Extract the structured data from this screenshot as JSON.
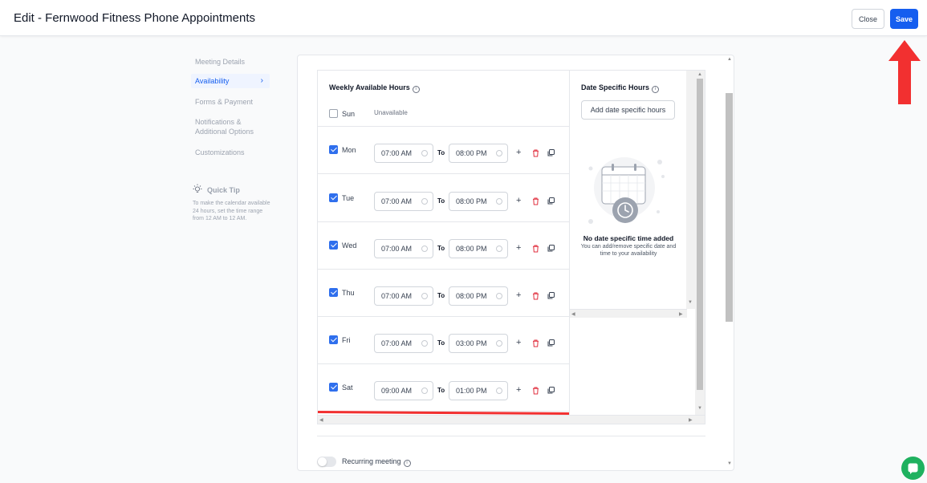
{
  "header": {
    "title": "Edit - Fernwood Fitness Phone Appointments",
    "close_label": "Close",
    "save_label": "Save"
  },
  "sidebar": {
    "items": [
      {
        "label": "Meeting Details"
      },
      {
        "label": "Availability",
        "active": true
      },
      {
        "label": "Forms & Payment"
      },
      {
        "label": "Notifications & Additional Options"
      },
      {
        "label": "Customizations"
      }
    ],
    "tip_title": "Quick Tip",
    "tip_text": "To make the calendar available 24 hours, set the time range from 12 AM to 12 AM."
  },
  "weekly": {
    "title": "Weekly Available Hours",
    "to_label": "To",
    "unavailable_label": "Unavailable",
    "days": [
      {
        "day": "Sun",
        "checked": false
      },
      {
        "day": "Mon",
        "checked": true,
        "from": "07:00 AM",
        "to": "08:00 PM"
      },
      {
        "day": "Tue",
        "checked": true,
        "from": "07:00 AM",
        "to": "08:00 PM"
      },
      {
        "day": "Wed",
        "checked": true,
        "from": "07:00 AM",
        "to": "08:00 PM"
      },
      {
        "day": "Thu",
        "checked": true,
        "from": "07:00 AM",
        "to": "08:00 PM"
      },
      {
        "day": "Fri",
        "checked": true,
        "from": "07:00 AM",
        "to": "03:00 PM"
      },
      {
        "day": "Sat",
        "checked": true,
        "from": "09:00 AM",
        "to": "01:00 PM"
      }
    ]
  },
  "date_specific": {
    "title": "Date Specific Hours",
    "add_button": "Add date specific hours",
    "empty_title": "No date specific time added",
    "empty_text": "You can add/remove specific date and time to your availability"
  },
  "recurring": {
    "label": "Recurring meeting",
    "enabled": false
  },
  "colors": {
    "primary": "#155eef",
    "check": "#2f6fed",
    "trash": "#e02d3c",
    "annotation_red": "#f23030",
    "chat": "#1fb15f"
  }
}
